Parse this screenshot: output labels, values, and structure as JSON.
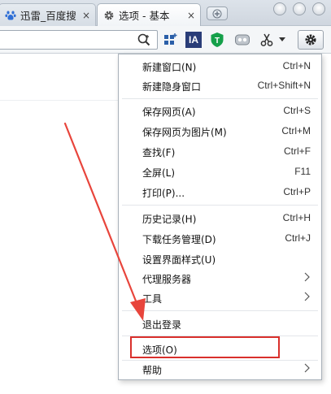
{
  "tabs": [
    {
      "label": "迅雷_百度搜",
      "close": "×"
    },
    {
      "label": "选项 - 基本",
      "close": "×"
    }
  ],
  "toolbar": {
    "ia_label": "IA",
    "settings_icon": "gear-icon"
  },
  "menu": {
    "items": [
      {
        "label": "新建窗口(N)",
        "shortcut": "Ctrl+N"
      },
      {
        "label": "新建隐身窗口",
        "shortcut": "Ctrl+Shift+N"
      },
      {
        "label": "保存网页(A)",
        "shortcut": "Ctrl+S"
      },
      {
        "label": "保存网页为图片(M)",
        "shortcut": "Ctrl+M"
      },
      {
        "label": "查找(F)",
        "shortcut": "Ctrl+F"
      },
      {
        "label": "全屏(L)",
        "shortcut": "F11"
      },
      {
        "label": "打印(P)...",
        "shortcut": "Ctrl+P"
      },
      {
        "label": "历史记录(H)",
        "shortcut": "Ctrl+H"
      },
      {
        "label": "下载任务管理(D)",
        "shortcut": "Ctrl+J"
      },
      {
        "label": "设置界面样式(U)",
        "shortcut": ""
      },
      {
        "label": "代理服务器",
        "shortcut": ""
      },
      {
        "label": "工具",
        "shortcut": ""
      },
      {
        "label": "退出登录",
        "shortcut": ""
      },
      {
        "label": "选项(O)",
        "shortcut": ""
      },
      {
        "label": "帮助",
        "shortcut": ""
      }
    ]
  },
  "colors": {
    "highlight": "#d9302c",
    "arrow": "#e8453c"
  }
}
